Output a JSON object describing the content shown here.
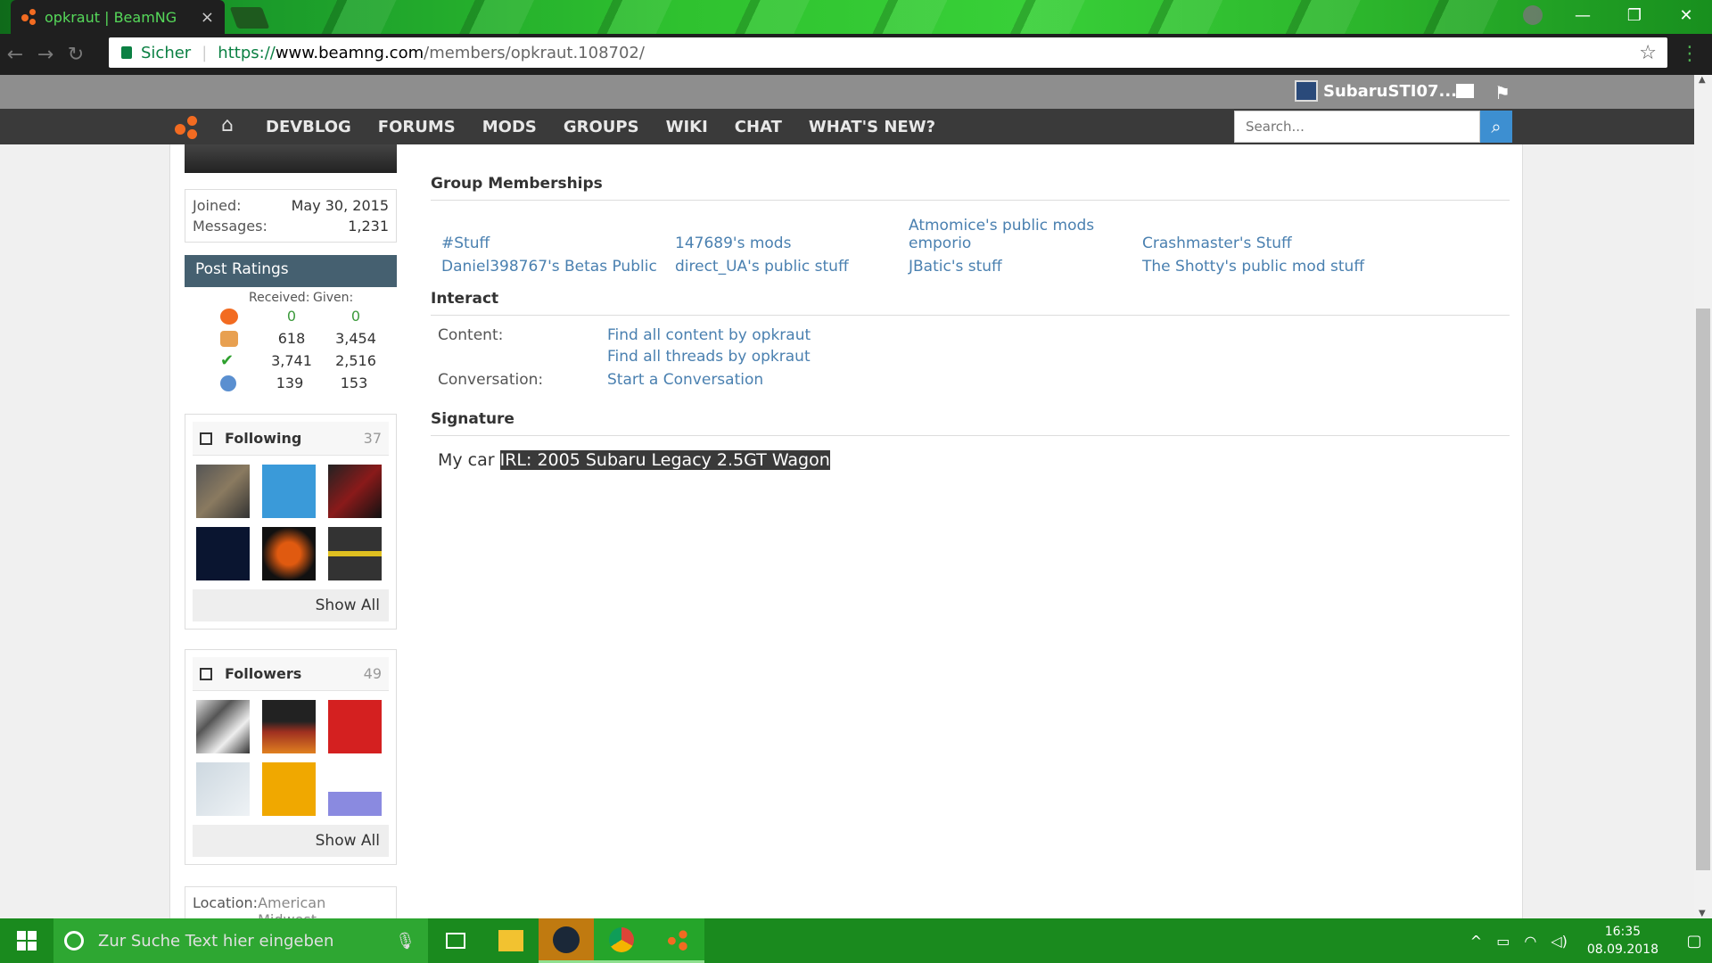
{
  "browser": {
    "tab_title": "opkraut | BeamNG",
    "tab_close": "×",
    "secure_label": "Sicher",
    "url_scheme": "https://",
    "url_host": "www.beamng.com",
    "url_path": "/members/opkraut.108702/",
    "window_min": "—",
    "window_max": "❐",
    "window_close": "✕"
  },
  "site": {
    "user_name": "SubaruSTI07...",
    "nav_links": [
      "DEVBLOG",
      "FORUMS",
      "MODS",
      "GROUPS",
      "WIKI",
      "CHAT",
      "WHAT'S NEW?"
    ],
    "search_placeholder": "Search...",
    "accent_color": "#f26b21"
  },
  "sidebar": {
    "joined_label": "Joined:",
    "joined_value": "May 30, 2015",
    "messages_label": "Messages:",
    "messages_value": "1,231",
    "ratings_title": "Post Ratings",
    "ratings_received": "Received:",
    "ratings_given": "Given:",
    "ratings": [
      {
        "icon": "beamng-icon",
        "received": "0",
        "given": "0"
      },
      {
        "icon": "thumbs-up-icon",
        "received": "618",
        "given": "3,454"
      },
      {
        "icon": "checkmark-icon",
        "received": "3,741",
        "given": "2,516"
      },
      {
        "icon": "info-icon",
        "received": "139",
        "given": "153"
      }
    ],
    "following_title": "Following",
    "following_count": "37",
    "followers_title": "Followers",
    "followers_count": "49",
    "show_all": "Show All",
    "location_label": "Location:",
    "location_value": "American Midwest"
  },
  "main": {
    "groups_title": "Group Memberships",
    "groups": [
      "#Stuff",
      "147689's mods",
      "Atmomice's public mods emporio",
      "Crashmaster's Stuff",
      "Daniel398767's Betas Public",
      "direct_UA's public stuff",
      "JBatic's stuff",
      "The Shotty's public mod stuff"
    ],
    "interact_title": "Interact",
    "content_label": "Content:",
    "content_links": [
      "Find all content by opkraut",
      "Find all threads by opkraut"
    ],
    "conversation_label": "Conversation:",
    "conversation_link": "Start a Conversation",
    "signature_title": "Signature",
    "signature_prefix": "My car",
    "signature_highlight": "IRL: 2005 Subaru Legacy 2.5GT Wagon"
  },
  "taskbar": {
    "search_placeholder": "Zur Suche Text hier eingeben",
    "time": "16:35",
    "date": "08.09.2018"
  }
}
